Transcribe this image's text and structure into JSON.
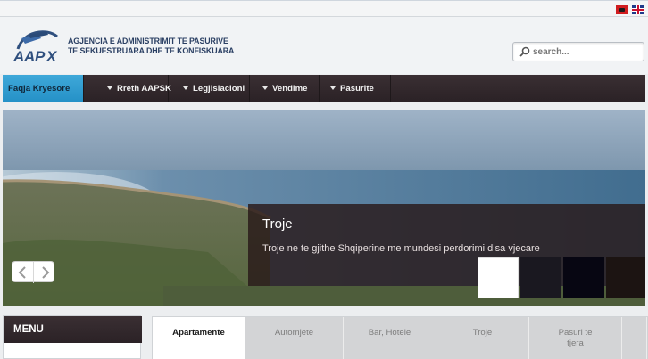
{
  "flags": [
    {
      "name": "Shqip",
      "color": "#d01c1f"
    },
    {
      "name": "English",
      "color": "#1f3a8a"
    }
  ],
  "header": {
    "logo_text_line1": "AGJENCIA E ADMINISTRIMIT TE PASURIVE",
    "logo_text_line2": "TE SEKUESTRUARA DHE TE KONFISKUARA",
    "logo_mark": "APSK",
    "search_placeholder": "search...",
    "search_value": ""
  },
  "nav": {
    "items": [
      {
        "label": "Faqja Kryesore",
        "dropdown": false,
        "active": true
      },
      {
        "label": "Rreth AAPSK",
        "dropdown": true,
        "active": false
      },
      {
        "label": "Legjislacioni",
        "dropdown": true,
        "active": false
      },
      {
        "label": "Vendime",
        "dropdown": true,
        "active": false
      },
      {
        "label": "Pasurite",
        "dropdown": true,
        "active": false
      }
    ],
    "accent": "#2d9ad0",
    "background": "#2f2529"
  },
  "slider": {
    "caption_title": "Troje",
    "caption_text": "Troje ne te gjithe Shqiperine me mundesi perdorimi disa vjecare",
    "thumbnails": 4,
    "active_thumbnail": 1
  },
  "sidebar": {
    "menu_title": "MENU"
  },
  "tabs": {
    "items": [
      {
        "label": "Apartamente",
        "active": true
      },
      {
        "label": "Automjete",
        "active": false
      },
      {
        "label": "Bar, Hotele",
        "active": false
      },
      {
        "label": "Troje",
        "active": false
      },
      {
        "label": "Pasuri te tjera",
        "active": false
      }
    ]
  }
}
